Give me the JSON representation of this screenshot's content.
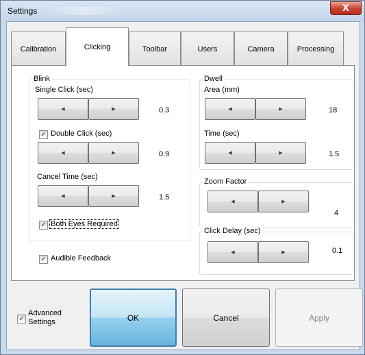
{
  "window": {
    "title": "Settings",
    "close_glyph": "X"
  },
  "tabs": [
    {
      "label": "Calibration",
      "active": false
    },
    {
      "label": "Clicking",
      "active": true
    },
    {
      "label": "Toolbar",
      "active": false
    },
    {
      "label": "Users",
      "active": false
    },
    {
      "label": "Camera",
      "active": false
    },
    {
      "label": "Processing",
      "active": false
    }
  ],
  "blink": {
    "legend": "Blink",
    "single_click": {
      "label": "Single Click (sec)",
      "value": "0.3"
    },
    "double_click": {
      "label": "Double Click (sec)",
      "value": "0.9",
      "checked": true
    },
    "cancel_time": {
      "label": "Cancel Time (sec)",
      "value": "1.5"
    },
    "both_eyes": {
      "label": "Both Eyes Required",
      "checked": true
    }
  },
  "audible_feedback": {
    "label": "Audible Feedback",
    "checked": true
  },
  "dwell": {
    "legend": "Dwell",
    "area": {
      "label": "Area (mm)",
      "value": "18"
    },
    "time": {
      "label": "Time (sec)",
      "value": "1.5"
    }
  },
  "zoom_factor": {
    "legend": "Zoom Factor",
    "value": "4"
  },
  "click_delay": {
    "legend": "Click Delay (sec)",
    "value": "0.1"
  },
  "arrows": {
    "left": "◀",
    "right": "▶",
    "check": "✓"
  },
  "advanced_settings": {
    "label_line1": "Advanced",
    "label_line2": "Settings",
    "checked": true
  },
  "buttons": {
    "ok": "OK",
    "cancel": "Cancel",
    "apply": "Apply"
  },
  "colors": {
    "accent": "#3c7fb1",
    "titlebar": "#c3d4ea",
    "close": "#c7402d"
  }
}
